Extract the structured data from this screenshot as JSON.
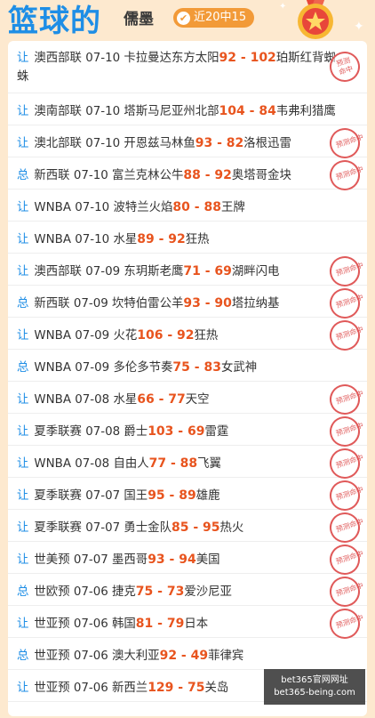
{
  "header": {
    "title": "篮球的",
    "expert": "儒墨",
    "streak": "近20中15",
    "streak_icon": "✔"
  },
  "stamp_text": "预测命中",
  "rows": [
    {
      "type": "让",
      "league": "澳西部联",
      "date": "07-10",
      "home": "卡拉曼达东方太阳",
      "home_score": "92",
      "sep": "-",
      "away_score": "102",
      "away": "珀斯红背蜘蛛",
      "hit": true,
      "tall": true
    },
    {
      "type": "让",
      "league": "澳南部联",
      "date": "07-10",
      "home": "塔斯马尼亚州北部",
      "home_score": "104",
      "sep": "-",
      "away_score": "84",
      "away": "韦弗利猎鹰",
      "hit": false
    },
    {
      "type": "让",
      "league": "澳北部联",
      "date": "07-10",
      "home": "开恩兹马林鱼",
      "home_score": "93",
      "sep": "-",
      "away_score": "82",
      "away": "洛根迅雷",
      "hit": true
    },
    {
      "type": "总",
      "league": "新西联",
      "date": "07-10",
      "home": "富兰克林公牛",
      "home_score": "88",
      "sep": "-",
      "away_score": "92",
      "away": "奥塔哥金块",
      "hit": true
    },
    {
      "type": "让",
      "league": "WNBA",
      "date": "07-10",
      "home": "波特兰火焰",
      "home_score": "80",
      "sep": "-",
      "away_score": "88",
      "away": "王牌",
      "hit": false
    },
    {
      "type": "让",
      "league": "WNBA",
      "date": "07-10",
      "home": "水星",
      "home_score": "89",
      "sep": "-",
      "away_score": "92",
      "away": "狂热",
      "hit": false
    },
    {
      "type": "让",
      "league": "澳西部联",
      "date": "07-09",
      "home": "东玥斯老鹰",
      "home_score": "71",
      "sep": "-",
      "away_score": "69",
      "away": "湖畔闪电",
      "hit": true
    },
    {
      "type": "总",
      "league": "新西联",
      "date": "07-09",
      "home": "坎特伯雷公羊",
      "home_score": "93",
      "sep": "-",
      "away_score": "90",
      "away": "塔拉纳基",
      "hit": true
    },
    {
      "type": "让",
      "league": "WNBA",
      "date": "07-09",
      "home": "火花",
      "home_score": "106",
      "sep": "-",
      "away_score": "92",
      "away": "狂热",
      "hit": true
    },
    {
      "type": "总",
      "league": "WNBA",
      "date": "07-09",
      "home": "多伦多节奏",
      "home_score": "75",
      "sep": "-",
      "away_score": "83",
      "away": "女武神",
      "hit": false
    },
    {
      "type": "让",
      "league": "WNBA",
      "date": "07-08",
      "home": "水星",
      "home_score": "66",
      "sep": "-",
      "away_score": "77",
      "away": "天空",
      "hit": true
    },
    {
      "type": "让",
      "league": "夏季联赛",
      "date": "07-08",
      "home": "爵士",
      "home_score": "103",
      "sep": "-",
      "away_score": "69",
      "away": "雷霆",
      "hit": true
    },
    {
      "type": "让",
      "league": "WNBA",
      "date": "07-08",
      "home": "自由人",
      "home_score": "77",
      "sep": "-",
      "away_score": "88",
      "away": "飞翼",
      "hit": true
    },
    {
      "type": "让",
      "league": "夏季联赛",
      "date": "07-07",
      "home": "国王",
      "home_score": "95",
      "sep": "-",
      "away_score": "89",
      "away": "雄鹿",
      "hit": true
    },
    {
      "type": "让",
      "league": "夏季联赛",
      "date": "07-07",
      "home": "勇士金队",
      "home_score": "85",
      "sep": "-",
      "away_score": "95",
      "away": "热火",
      "hit": true
    },
    {
      "type": "让",
      "league": "世美预",
      "date": "07-07",
      "home": "墨西哥",
      "home_score": "93",
      "sep": "-",
      "away_score": "94",
      "away": "美国",
      "hit": true
    },
    {
      "type": "总",
      "league": "世欧预",
      "date": "07-06",
      "home": "捷克",
      "home_score": "75",
      "sep": "-",
      "away_score": "73",
      "away": "爱沙尼亚",
      "hit": true
    },
    {
      "type": "让",
      "league": "世亚预",
      "date": "07-06",
      "home": "韩国",
      "home_score": "81",
      "sep": "-",
      "away_score": "79",
      "away": "日本",
      "hit": true
    },
    {
      "type": "总",
      "league": "世亚预",
      "date": "07-06",
      "home": "澳大利亚",
      "home_score": "92",
      "sep": "-",
      "away_score": "49",
      "away": "菲律宾",
      "hit": false
    },
    {
      "type": "让",
      "league": "世亚预",
      "date": "07-06",
      "home": "新西兰",
      "home_score": "129",
      "sep": "-",
      "away_score": "75",
      "away": "关岛",
      "hit": false
    }
  ],
  "watermark": {
    "line1": "bet365官网网址",
    "line2": "bet365-being.com"
  }
}
